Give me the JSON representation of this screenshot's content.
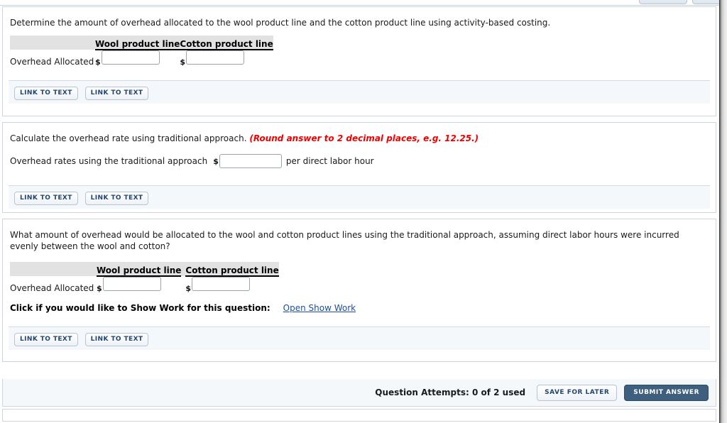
{
  "window": {
    "scroll_gutter": true,
    "accent_link_color": "#1a4f9c",
    "hint_color": "#ee0000",
    "submit_button_color": "#3e5f7d",
    "table_header_bg": "#e2e2e2",
    "footer_bar_bg": "#f4f8fb"
  },
  "questions": [
    {
      "id": "q1",
      "prompt": "Determine the amount of overhead allocated to the wool product line and the cotton product line using activity-based costing.",
      "table": {
        "blank_header": "",
        "headers": [
          "Wool product line",
          "Cotton product line"
        ],
        "row_label": "Overhead Allocated",
        "currency_symbol": "$",
        "values": [
          "",
          ""
        ],
        "placeholders": [
          "",
          ""
        ]
      },
      "footer_buttons": [
        "LINK TO TEXT",
        "LINK TO TEXT"
      ]
    },
    {
      "id": "q2",
      "prompt": "Calculate the overhead rate using traditional approach.",
      "hint": "(Round answer to 2 decimal places, e.g. 12.25.)",
      "rate_row": {
        "label": "Overhead rates using the traditional approach",
        "currency_symbol": "$",
        "value": "",
        "placeholder": "",
        "unit": "per direct labor hour"
      },
      "footer_buttons": [
        "LINK TO TEXT",
        "LINK TO TEXT"
      ]
    },
    {
      "id": "q3",
      "prompt": "What amount of overhead would be allocated to the wool and cotton product lines using the traditional approach, assuming direct labor hours were incurred evenly between the wool and cotton?",
      "table": {
        "blank_header": "",
        "headers": [
          "Wool product line",
          "Cotton product line"
        ],
        "row_label": "Overhead Allocated",
        "currency_symbol": "$",
        "values": [
          "",
          ""
        ],
        "placeholders": [
          "",
          ""
        ]
      },
      "show_work": {
        "label": "Click if you would like to Show Work for this question:",
        "link": "Open Show Work"
      },
      "footer_buttons": [
        "LINK TO TEXT",
        "LINK TO TEXT"
      ]
    }
  ],
  "action_bar": {
    "attempts_text": "Question Attempts: 0 of 2 used",
    "save_label": "SAVE FOR LATER",
    "submit_label": "SUBMIT ANSWER"
  }
}
